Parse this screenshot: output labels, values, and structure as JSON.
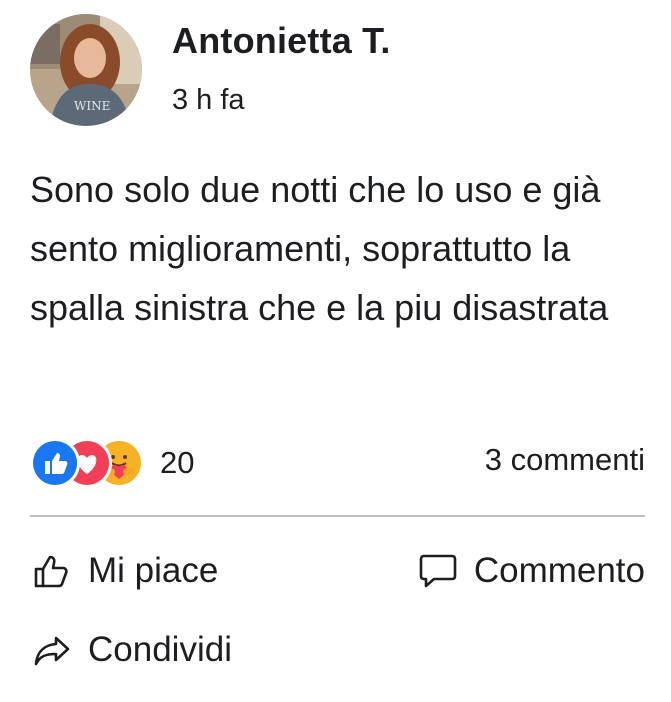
{
  "post": {
    "author": "Antonietta T.",
    "time": "3 h fa",
    "text": "Sono solo due notti che lo uso e già sento miglioramenti, soprattutto la spalla sinistra che e la piu disastrata"
  },
  "reactions": {
    "icons": [
      "like-reaction-icon",
      "love-reaction-icon",
      "care-reaction-icon"
    ],
    "count": "20",
    "comments": "3 commenti"
  },
  "actions": {
    "like": "Mi piace",
    "comment": "Commento",
    "share": "Condividi"
  },
  "colors": {
    "like_blue": "#1877f2",
    "love_red": "#f33e58",
    "care_yellow": "#f7b125",
    "divider": "#bcc0c4"
  }
}
